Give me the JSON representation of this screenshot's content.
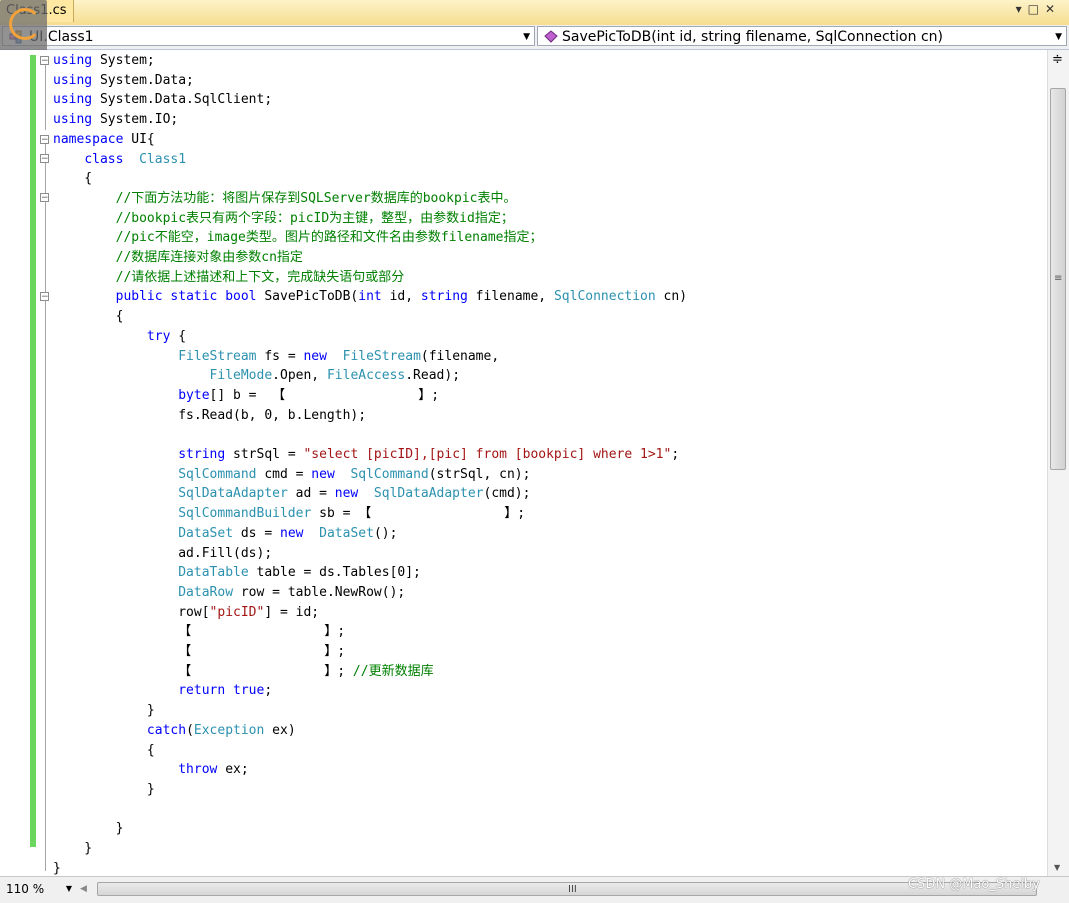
{
  "tab": {
    "title": "Class1.cs"
  },
  "window_buttons": {
    "dropdown": "▾",
    "maximize": "□",
    "close": "✕"
  },
  "navbar": {
    "class_selector": "UI.Class1",
    "member_selector": "SavePicToDB(int id, string filename, SqlConnection cn)"
  },
  "code_lines": [
    [
      [
        "kw",
        "using"
      ],
      [
        "",
        "System;"
      ]
    ],
    [
      [
        "kw",
        "using"
      ],
      [
        "",
        "System.Data;"
      ]
    ],
    [
      [
        "kw",
        "using"
      ],
      [
        "",
        "System.Data.SqlClient;"
      ]
    ],
    [
      [
        "kw",
        "using"
      ],
      [
        "",
        "System.IO;"
      ]
    ],
    [
      [
        "kw",
        "namespace"
      ],
      [
        "",
        "UI{"
      ]
    ],
    [
      [
        "",
        "    "
      ],
      [
        "kw",
        "class"
      ],
      [
        "",
        ""
      ],
      [
        "ty",
        "Class1"
      ]
    ],
    [
      [
        "",
        "    {"
      ]
    ],
    [
      [
        "cm",
        "        //下面方法功能：将图片保存到SQLServer数据库的bookpic表中。"
      ]
    ],
    [
      [
        "cm",
        "        //bookpic表只有两个字段：picID为主键，整型，由参数id指定；"
      ]
    ],
    [
      [
        "cm",
        "        //pic不能空，image类型。图片的路径和文件名由参数filename指定；"
      ]
    ],
    [
      [
        "cm",
        "        //数据库连接对象由参数cn指定"
      ]
    ],
    [
      [
        "cm",
        "        //请依据上述描述和上下文，完成缺失语句或部分"
      ]
    ],
    [
      [
        "",
        "        "
      ],
      [
        "kw",
        "public static bool"
      ],
      [
        "",
        "SavePicToDB("
      ],
      [
        "kw",
        "int"
      ],
      [
        "",
        "id,"
      ],
      [
        "kw",
        "string"
      ],
      [
        "",
        "filename,"
      ],
      [
        "ty",
        "SqlConnection"
      ],
      [
        "",
        "cn)"
      ]
    ],
    [
      [
        "",
        "        {"
      ]
    ],
    [
      [
        "",
        "            "
      ],
      [
        "kw",
        "try"
      ],
      [
        "",
        "{"
      ]
    ],
    [
      [
        "",
        "                "
      ],
      [
        "ty",
        "FileStream"
      ],
      [
        "",
        "fs ="
      ],
      [
        "kw",
        "new"
      ],
      [
        "",
        ""
      ],
      [
        "ty",
        "FileStream"
      ],
      [
        "",
        "(filename,"
      ]
    ],
    [
      [
        "",
        "                    "
      ],
      [
        "ty",
        "FileMode"
      ],
      [
        "",
        ".Open,"
      ],
      [
        "ty",
        "FileAccess"
      ],
      [
        "",
        ".Read);"
      ]
    ],
    [
      [
        "",
        "                "
      ],
      [
        "kw",
        "byte"
      ],
      [
        "",
        "[] b =  【                 】;"
      ]
    ],
    [
      [
        "",
        "                fs.Read(b, 0, b.Length);"
      ]
    ],
    [
      [
        "",
        ""
      ]
    ],
    [
      [
        "",
        "                "
      ],
      [
        "kw",
        "string"
      ],
      [
        "",
        "strSql ="
      ],
      [
        "str",
        "\"select [picID],[pic] from [bookpic] where 1>1\""
      ],
      [
        "",
        ";"
      ]
    ],
    [
      [
        "",
        "                "
      ],
      [
        "ty",
        "SqlCommand"
      ],
      [
        "",
        "cmd ="
      ],
      [
        "kw",
        "new"
      ],
      [
        "",
        ""
      ],
      [
        "ty",
        "SqlCommand"
      ],
      [
        "",
        "(strSql, cn);"
      ]
    ],
    [
      [
        "",
        "                "
      ],
      [
        "ty",
        "SqlDataAdapter"
      ],
      [
        "",
        "ad ="
      ],
      [
        "kw",
        "new"
      ],
      [
        "",
        ""
      ],
      [
        "ty",
        "SqlDataAdapter"
      ],
      [
        "",
        "(cmd);"
      ]
    ],
    [
      [
        "",
        "                "
      ],
      [
        "ty",
        "SqlCommandBuilder"
      ],
      [
        "",
        "sb = 【                 】;"
      ]
    ],
    [
      [
        "",
        "                "
      ],
      [
        "ty",
        "DataSet"
      ],
      [
        "",
        "ds ="
      ],
      [
        "kw",
        "new"
      ],
      [
        "",
        ""
      ],
      [
        "ty",
        "DataSet"
      ],
      [
        "",
        "();"
      ]
    ],
    [
      [
        "",
        "                ad.Fill(ds);"
      ]
    ],
    [
      [
        "",
        "                "
      ],
      [
        "ty",
        "DataTable"
      ],
      [
        "",
        "table = ds.Tables[0];"
      ]
    ],
    [
      [
        "",
        "                "
      ],
      [
        "ty",
        "DataRow"
      ],
      [
        "",
        "row = table.NewRow();"
      ]
    ],
    [
      [
        "",
        "                row["
      ],
      [
        "str",
        "\"picID\""
      ],
      [
        "",
        "] = id;"
      ]
    ],
    [
      [
        "",
        "                【                 】;"
      ]
    ],
    [
      [
        "",
        "                【                 】;"
      ]
    ],
    [
      [
        "",
        "                【                 】;"
      ],
      [
        "cm",
        "//更新数据库"
      ]
    ],
    [
      [
        "",
        "                "
      ],
      [
        "kw",
        "return true"
      ],
      [
        "",
        ";"
      ]
    ],
    [
      [
        "",
        "            }"
      ]
    ],
    [
      [
        "",
        "            "
      ],
      [
        "kw",
        "catch"
      ],
      [
        "",
        "("
      ],
      [
        "ty",
        "Exception"
      ],
      [
        "",
        "ex)"
      ]
    ],
    [
      [
        "",
        "            {"
      ]
    ],
    [
      [
        "",
        "                "
      ],
      [
        "kw",
        "throw"
      ],
      [
        "",
        "ex;"
      ]
    ],
    [
      [
        "",
        "            }"
      ]
    ],
    [
      [
        "",
        ""
      ]
    ],
    [
      [
        "",
        "        }"
      ]
    ],
    [
      [
        "",
        "    }"
      ]
    ],
    [
      [
        "",
        "}"
      ]
    ]
  ],
  "statusbar": {
    "zoom": "110 %",
    "hscroll_grip": "III"
  },
  "scrollbar": {
    "split_glyph": "≑",
    "mid_glyph": "≡"
  },
  "watermark": "CSDN @Mao_Shelby",
  "colors": {
    "keyword": "#0000ff",
    "type": "#2b91af",
    "string": "#a31515",
    "comment": "#008000",
    "change_margin": "#6ad65d"
  }
}
